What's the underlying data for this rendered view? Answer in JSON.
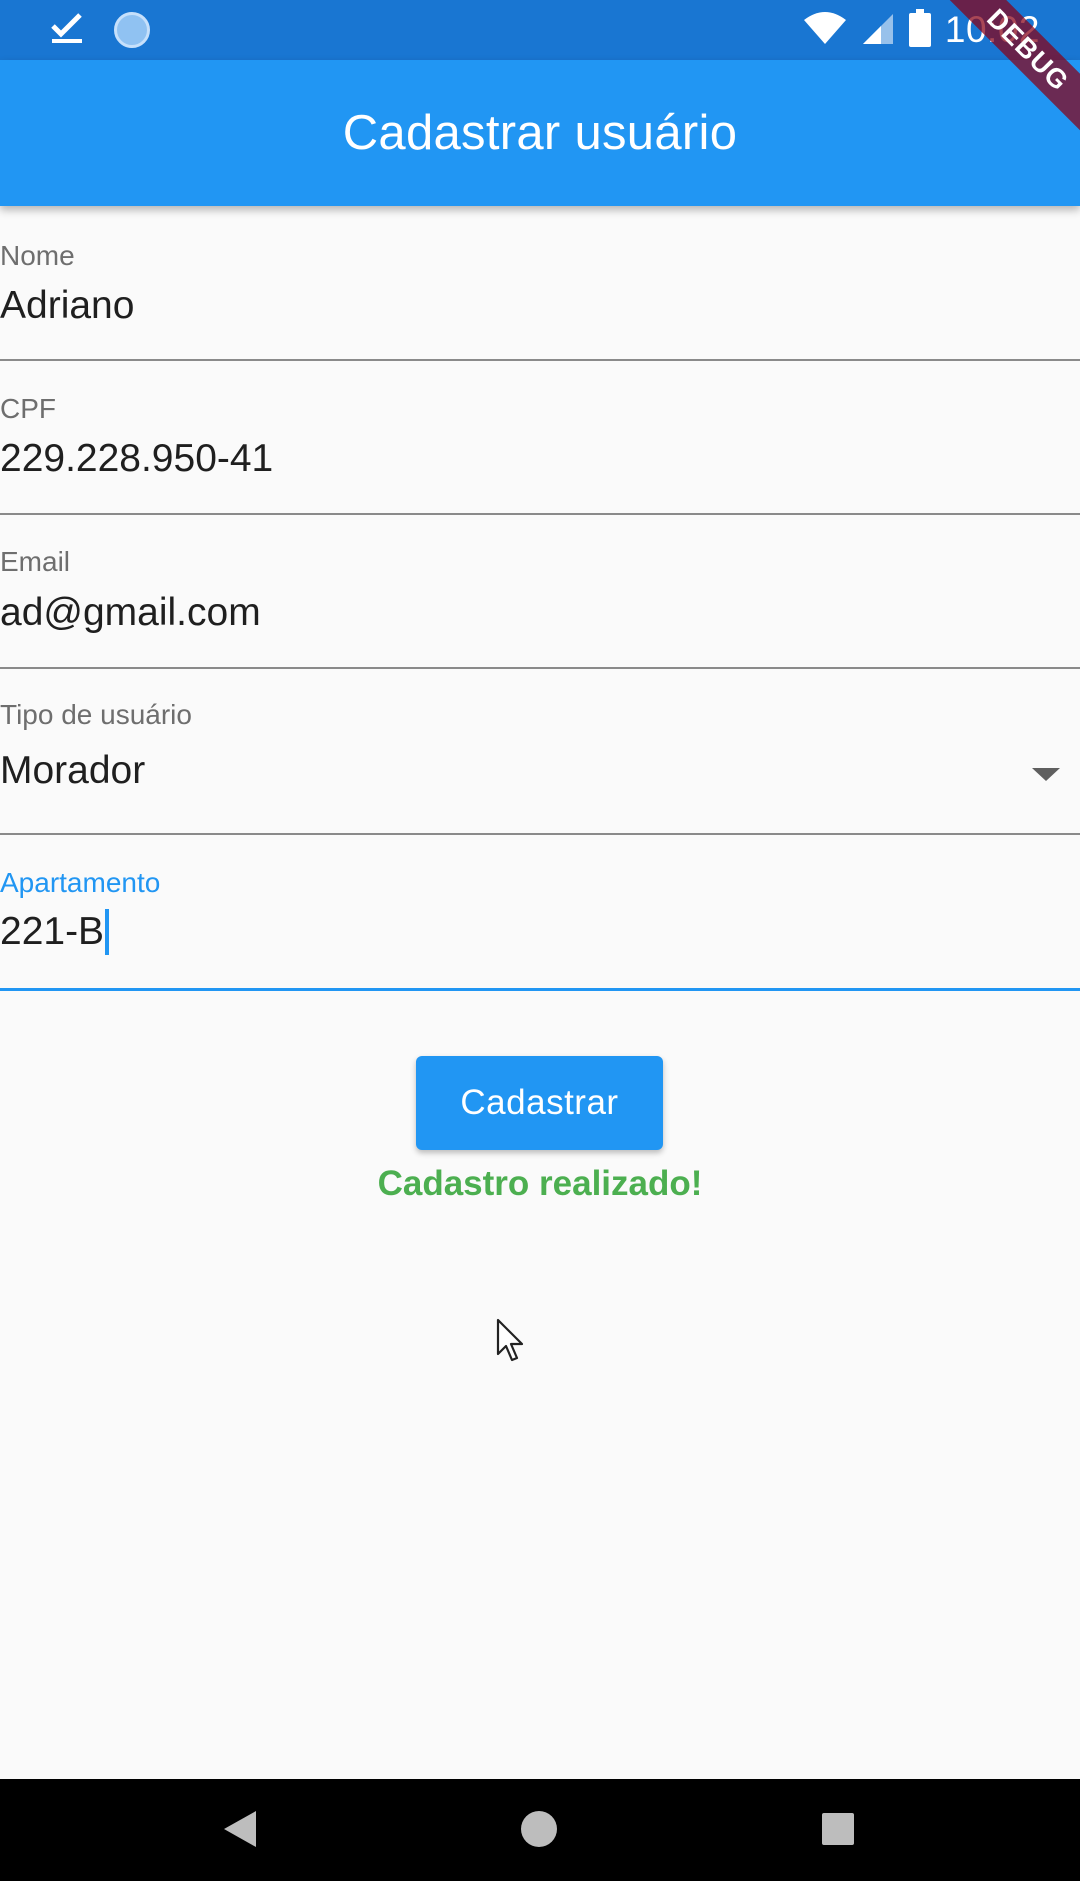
{
  "status_bar": {
    "time": "10:02",
    "icons": [
      "check-download-icon",
      "circle-notification-icon",
      "wifi-icon",
      "cell-signal-icon",
      "battery-icon"
    ]
  },
  "app_bar": {
    "title": "Cadastrar usuário"
  },
  "debug_banner": "DEBUG",
  "form": {
    "nome": {
      "label": "Nome",
      "value": "Adriano"
    },
    "cpf": {
      "label": "CPF",
      "value": "229.228.950-41"
    },
    "email": {
      "label": "Email",
      "value": "ad@gmail.com"
    },
    "tipo": {
      "label": "Tipo de usuário",
      "value": "Morador"
    },
    "apartamento": {
      "label": "Apartamento",
      "value": "221-B"
    }
  },
  "submit_button": {
    "label": "Cadastrar"
  },
  "success_message": "Cadastro realizado!",
  "colors": {
    "primary": "#2196f3",
    "status_bar": "#1976d2",
    "success": "#4caf50"
  },
  "nav_bar": {
    "icons": [
      "back-icon",
      "home-icon",
      "recents-icon"
    ]
  }
}
